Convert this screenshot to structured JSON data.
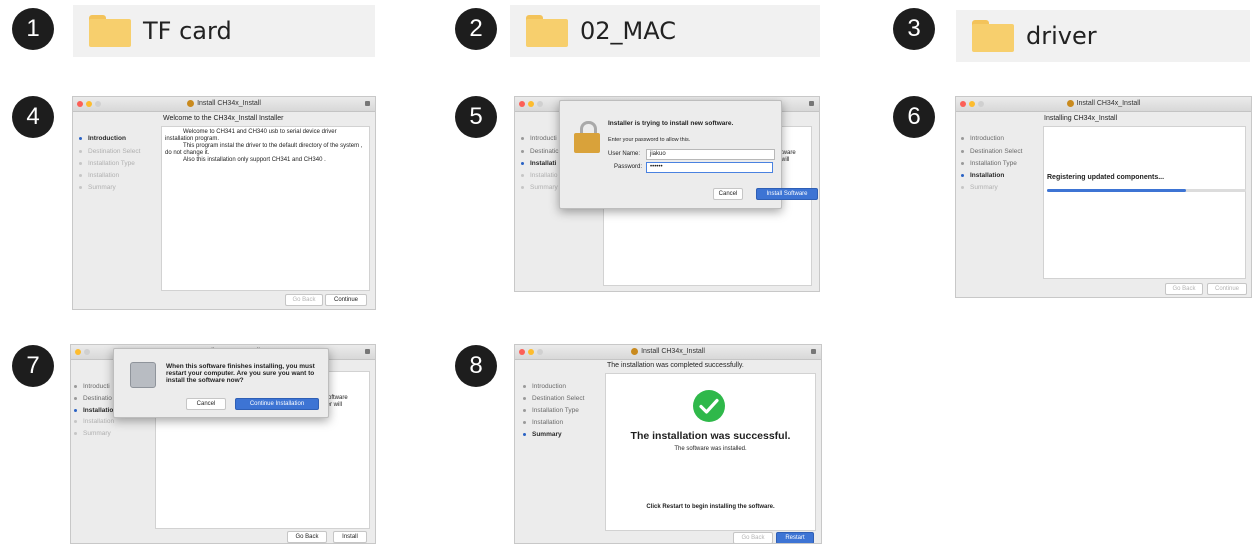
{
  "steps": [
    "1",
    "2",
    "3",
    "4",
    "5",
    "6",
    "7",
    "8"
  ],
  "folders": [
    {
      "label": "TF card",
      "icon": "folder-icon"
    },
    {
      "label": "02_MAC",
      "icon": "folder-icon"
    },
    {
      "label": "driver",
      "icon": "folder-icon"
    }
  ],
  "installer": {
    "title": "Install CH34x_Install",
    "sidebar": [
      "Introduction",
      "Destination Select",
      "Installation Type",
      "Installation",
      "Summary"
    ],
    "go_back": "Go Back",
    "continue": "Continue",
    "install": "Install",
    "restart": "Restart"
  },
  "win4": {
    "heading": "Welcome to the CH34x_Install Installer",
    "body": [
      "Welcome to CH341 and CH340 usb to serial device driver installation program.",
      "This program instal the driver to the default directory of the system , do not change it.",
      "Also this installation only support CH341 and CH340 ."
    ]
  },
  "win5": {
    "bg_peek": [
      "Introducti",
      "Destinatic",
      "Installati",
      "Installatio",
      "Summary"
    ],
    "bg_right": [
      "tware",
      "will"
    ],
    "dialog_title": "Installer is trying to install new software.",
    "dialog_prompt": "Enter your password to allow this.",
    "username_label": "User Name:",
    "username_value": "jiakuo",
    "password_label": "Password:",
    "password_value": "••••••",
    "cancel": "Cancel",
    "install_software": "Install Software"
  },
  "win6": {
    "heading": "Installing CH34x_Install",
    "status": "Registering updated components...",
    "progress": 0.7
  },
  "win7": {
    "bg_peek": [
      "Introducti",
      "Destinatio",
      "Installatio",
      "Installation",
      "Summary"
    ],
    "bg_right": [
      "software",
      "ter will"
    ],
    "dialog_text": "When this software finishes installing, you must restart your computer. Are you sure you want to install the software now?",
    "cancel": "Cancel",
    "continue_installation": "Continue Installation"
  },
  "win8": {
    "heading": "The installation was completed successfully.",
    "success_title": "The installation was successful.",
    "success_sub": "The software was installed.",
    "restart_hint": "Click Restart to begin installing the software."
  },
  "colors": {
    "badge": "#1d1d1d",
    "folder": "#f7cf6d",
    "accent_blue": "#3d74d4",
    "success_green": "#2fb84a",
    "light_red": "#fc5f57",
    "light_yellow": "#fdbc2e",
    "light_gray": "#d0d0d0"
  }
}
